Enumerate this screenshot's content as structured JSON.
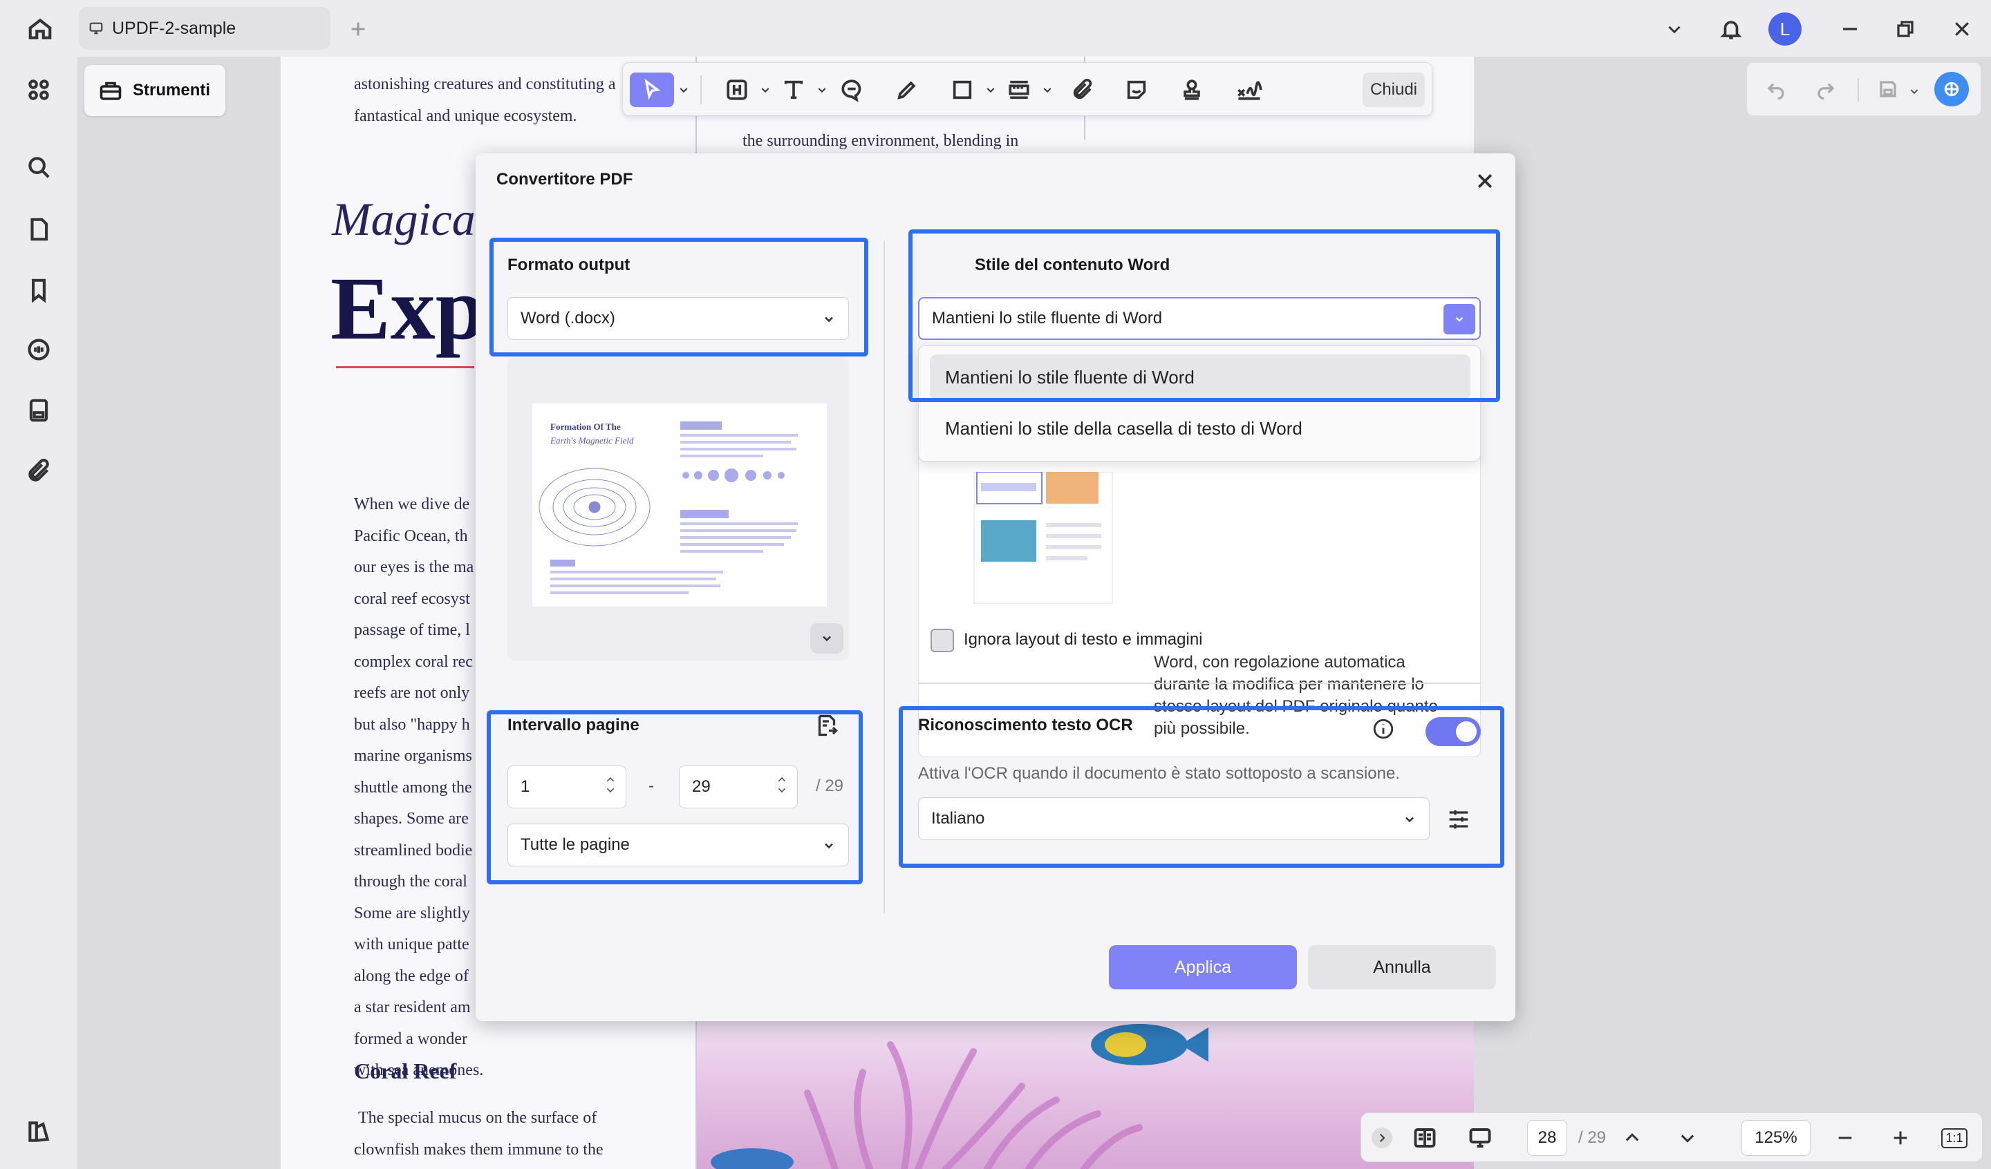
{
  "titlebar": {
    "tab_title": "UPDF-2-sample",
    "avatar_letter": "L"
  },
  "tools_button": {
    "label": "Strumenti"
  },
  "edit_toolbar": {
    "close_label": "Chiudi"
  },
  "document": {
    "top_left_lines": [
      "astonishing creatures and constituting a",
      "fantastical and unique ecosystem."
    ],
    "top_mid_line": "the surrounding environment, blending in",
    "title_italic": "Magica",
    "title_big": "Exp",
    "body_lines": [
      "When we dive de",
      "Pacific Ocean, th",
      "our eyes is the ma",
      "coral reef ecosyst",
      "passage of time, l",
      "complex coral rec",
      "reefs are not only",
      "but also \"happy h",
      "marine organisms",
      "shuttle among the",
      "shapes. Some are",
      "streamlined bodie",
      "through the coral",
      "Some are slightly",
      "with unique patte",
      "along the edge of",
      "a star resident am",
      "formed a wonder",
      "with sea anemones."
    ],
    "section_heading": "Coral Reef",
    "bottom_lines": [
      "The special mucus on the surface of",
      "clownfish makes them immune to the"
    ]
  },
  "dialog": {
    "title": "Convertitore PDF",
    "output_format": {
      "label": "Formato output",
      "value": "Word (.docx)"
    },
    "preview_thumb": {
      "title_line1": "Formation Of The",
      "title_line2": "Earth's Magnetic Field"
    },
    "word_style": {
      "label": "Stile del contenuto Word",
      "value": "Mantieni lo stile fluente di Word",
      "options": [
        "Mantieni lo stile fluente di Word",
        "Mantieni lo stile della casella di testo di Word"
      ],
      "description": "Word, con regolazione automatica durante la modifica per mantenere lo stesso layout del PDF originale quanto più possibile."
    },
    "ignore_layout": {
      "label": "Ignora layout di testo e immagini",
      "checked": false
    },
    "page_range": {
      "label": "Intervallo pagine",
      "from": "1",
      "dash": "-",
      "to": "29",
      "total": "/ 29",
      "subset": "Tutte le pagine"
    },
    "ocr": {
      "label": "Riconoscimento testo OCR",
      "enabled": true,
      "hint": "Attiva l'OCR quando il documento è stato sottoposto a scansione.",
      "language": "Italiano"
    },
    "apply_label": "Applica",
    "cancel_label": "Annulla"
  },
  "bottom_bar": {
    "current_page": "28",
    "total_pages": "/ 29",
    "zoom": "125%",
    "fit_label": "1:1"
  },
  "colors": {
    "accent": "#7f83f5",
    "highlight": "#2f6ef0",
    "avatar": "#4b63e6"
  }
}
